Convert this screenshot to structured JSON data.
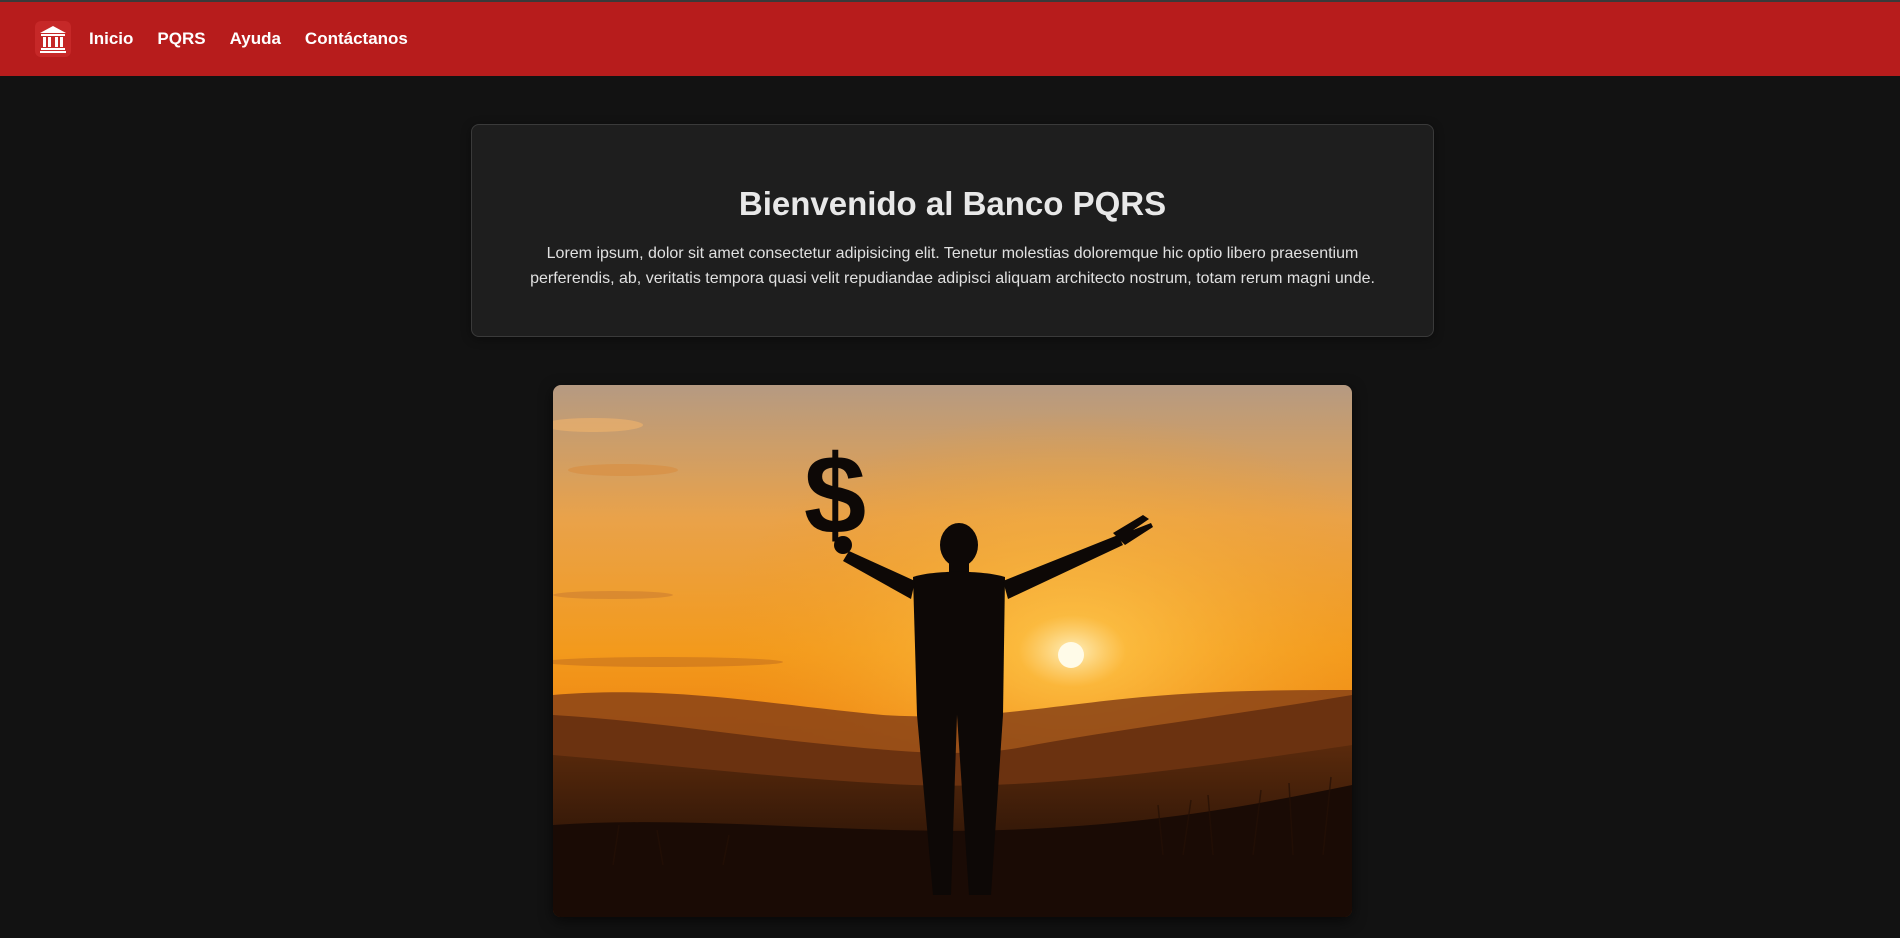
{
  "header": {
    "logo_icon": "bank-icon",
    "nav": [
      {
        "label": "Inicio"
      },
      {
        "label": "PQRS"
      },
      {
        "label": "Ayuda"
      },
      {
        "label": "Contáctanos"
      }
    ],
    "bg_color": "#b71c1c"
  },
  "hero": {
    "title": "Bienvenido al Banco PQRS",
    "text": "Lorem ipsum, dolor sit amet consectetur adipisicing elit. Tenetur molestias doloremque hic optio libero praesentium perferendis, ab, veritatis tempora quasi velit repudiandae adipisci aliquam architecto nostrum, totam rerum magni unde."
  },
  "banner": {
    "image_subject": "silhouette-sunset-dollar",
    "symbol": "$"
  }
}
